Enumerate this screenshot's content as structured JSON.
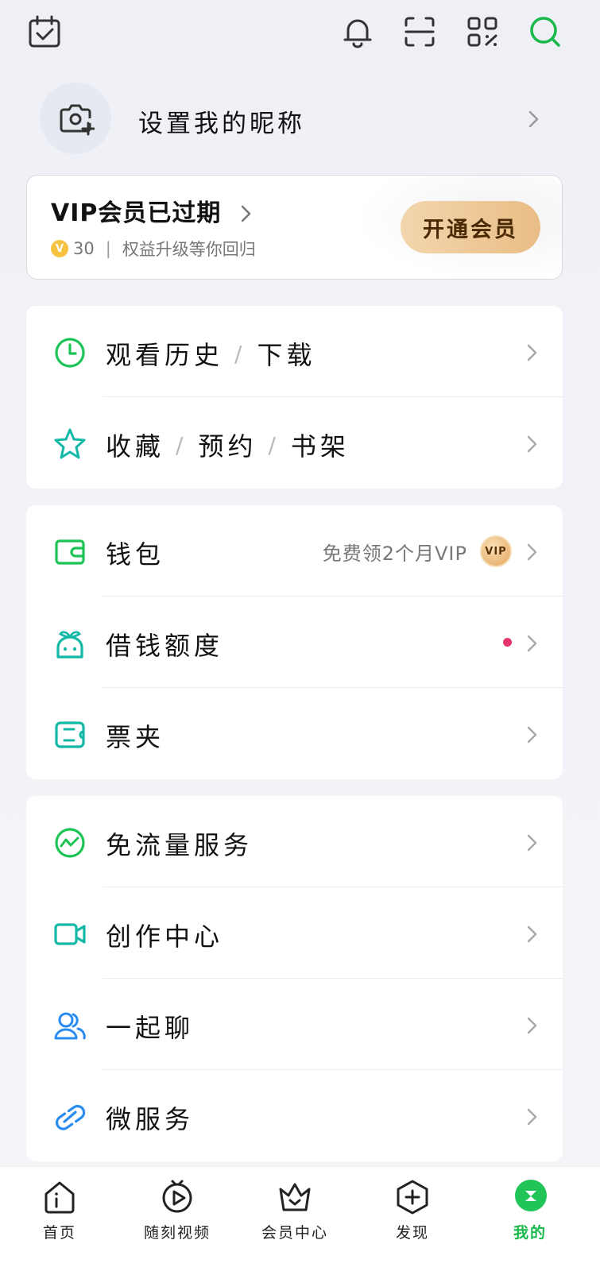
{
  "topbar": {
    "icons": [
      "calendar-check-icon",
      "bell-icon",
      "scan-icon",
      "qr-code-icon",
      "search-icon"
    ]
  },
  "profile": {
    "nickname_prompt": "设置我的昵称"
  },
  "vip": {
    "title": "VIP会员已过期",
    "coin_value": "30",
    "coin_symbol": "V",
    "separator": "|",
    "subtitle": "权益升级等你回归",
    "button_label": "开通会员"
  },
  "groups": [
    {
      "rows": [
        {
          "parts": [
            "观看历史",
            "下载"
          ],
          "icon": "clock-icon"
        },
        {
          "parts": [
            "收藏",
            "预约",
            "书架"
          ],
          "icon": "star-icon"
        }
      ]
    },
    {
      "rows": [
        {
          "label": "钱包",
          "icon": "wallet-icon",
          "extra": "免费领2个月VIP",
          "badge": "VIP"
        },
        {
          "label": "借钱额度",
          "icon": "sprout-icon",
          "has_dot": true
        },
        {
          "label": "票夹",
          "icon": "ticket-icon"
        }
      ]
    },
    {
      "rows": [
        {
          "label": "免流量服务",
          "icon": "data-flow-icon"
        },
        {
          "label": "创作中心",
          "icon": "video-camera-icon"
        },
        {
          "label": "一起聊",
          "icon": "chat-users-icon"
        },
        {
          "label": "微服务",
          "icon": "link-icon"
        }
      ]
    }
  ],
  "nav": {
    "items": [
      {
        "label": "首页",
        "icon": "home-icon"
      },
      {
        "label": "随刻视频",
        "icon": "play-icon"
      },
      {
        "label": "会员中心",
        "icon": "crown-icon"
      },
      {
        "label": "发现",
        "icon": "plus-icon"
      },
      {
        "label": "我的",
        "icon": "profile-icon",
        "active": true
      }
    ]
  },
  "colors": {
    "accent_green": "#19b84a",
    "vip_gold": "#e9bd85",
    "dot_red": "#e6356a",
    "icon_teal": "#14b8a6"
  }
}
